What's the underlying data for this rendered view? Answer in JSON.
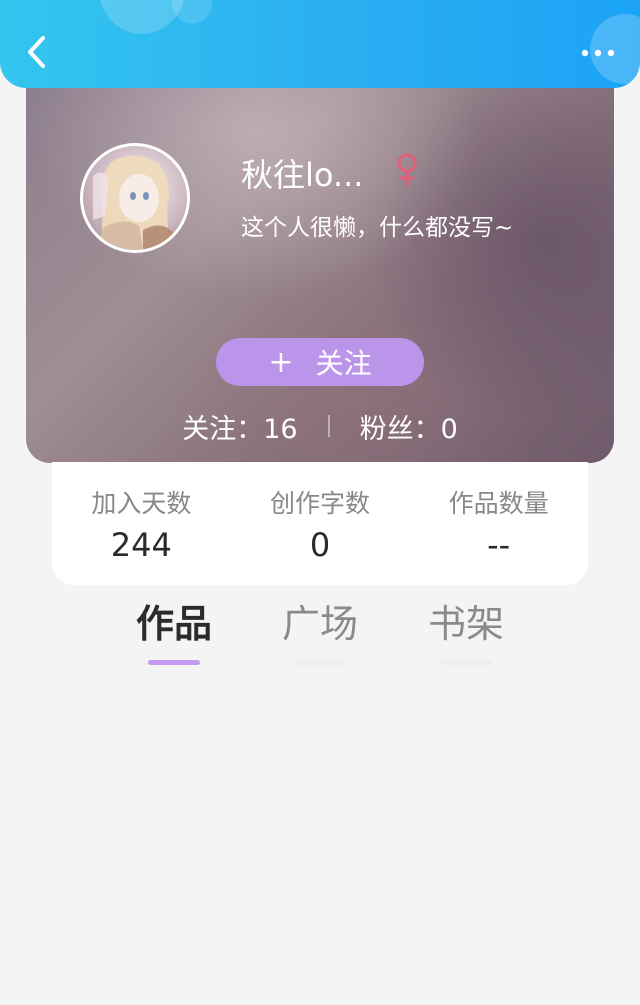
{
  "colors": {
    "header_accent": "#2aaef1",
    "follow_button": "#bb95e9",
    "tab_active_indicator": "#c39af0",
    "gender_icon": "#e0607a"
  },
  "header": {
    "back_icon": "chevron-left-icon",
    "more_icon": "more-horizontal-icon"
  },
  "profile": {
    "nickname": "秋往lo...",
    "gender_icon": "female-icon",
    "bio": "这个人很懒，什么都没写~",
    "follow_plus": "+",
    "follow_label": "关注",
    "following_text": "关注：16",
    "followers_text": "粉丝：0"
  },
  "stats": [
    {
      "label": "加入天数",
      "value": "244"
    },
    {
      "label": "创作字数",
      "value": "0"
    },
    {
      "label": "作品数量",
      "value": "--"
    }
  ],
  "tabs": [
    {
      "label": "作品",
      "active": true
    },
    {
      "label": "广场",
      "active": false
    },
    {
      "label": "书架",
      "active": false
    }
  ]
}
